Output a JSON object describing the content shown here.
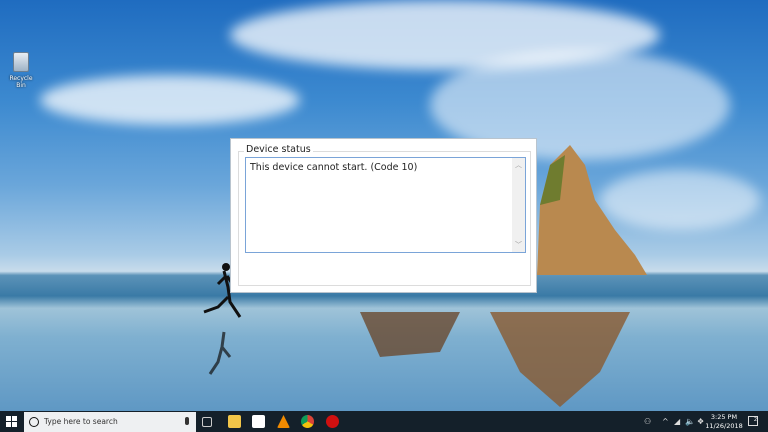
{
  "desktop": {
    "icons": [
      {
        "label": "Recycle Bin",
        "icon": "recycle-bin-icon"
      }
    ]
  },
  "dialog": {
    "group_label": "Device status",
    "status_text": "This device cannot start. (Code 10)"
  },
  "taskbar": {
    "search_placeholder": "Type here to search",
    "pinned": [
      {
        "name": "task-view",
        "icon": "task-view-icon"
      },
      {
        "name": "file-explorer",
        "icon": "folder-icon",
        "color": "#f2c649"
      },
      {
        "name": "microsoft-store",
        "icon": "store-icon",
        "color": "#ffffff"
      },
      {
        "name": "vlc",
        "icon": "vlc-cone-icon",
        "color": "#f08a00"
      },
      {
        "name": "chrome",
        "icon": "chrome-icon",
        "color": "#db4437"
      },
      {
        "name": "red-app",
        "icon": "red-circle-icon",
        "color": "#d01010"
      }
    ],
    "time": "3:25 PM",
    "date": "11/26/2018",
    "notification_count": "2"
  }
}
